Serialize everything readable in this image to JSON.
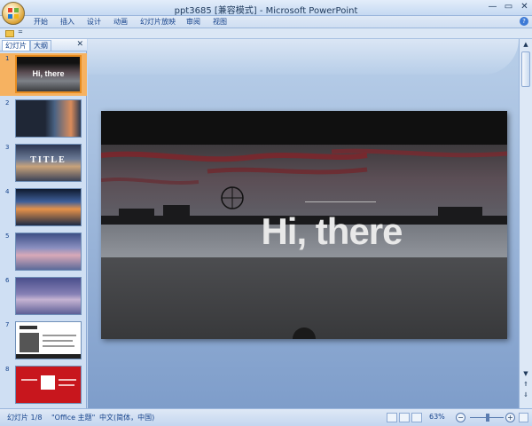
{
  "window": {
    "title": "ppt3685 [兼容模式] - Microsoft PowerPoint",
    "minimize": "—",
    "maximize": "▭",
    "close": "✕"
  },
  "ribbon_tabs": [
    "开始",
    "插入",
    "设计",
    "动画",
    "幻灯片放映",
    "审阅",
    "视图"
  ],
  "quick_access": {
    "dropdown": "="
  },
  "left_pane": {
    "tabs": [
      "幻灯片",
      "大纲"
    ],
    "close": "✕",
    "slides": [
      {
        "number": "1",
        "label": "Hi, there",
        "selected": true
      },
      {
        "number": "2",
        "label": "",
        "selected": false
      },
      {
        "number": "3",
        "label": "TITLE",
        "selected": false
      },
      {
        "number": "4",
        "label": "",
        "selected": false
      },
      {
        "number": "5",
        "label": "",
        "selected": false
      },
      {
        "number": "6",
        "label": "",
        "selected": false
      },
      {
        "number": "7",
        "label": "",
        "selected": false
      },
      {
        "number": "8",
        "label": "",
        "selected": false
      }
    ]
  },
  "slide": {
    "title": "Hi, there"
  },
  "status_bar": {
    "slide_position": "幻灯片 1/8",
    "theme": "\"Office 主题\"",
    "language": "中文(简体，中国)",
    "zoom": "63%",
    "zoom_out": "−",
    "zoom_in": "+"
  },
  "colors": {
    "selected_thumb": "#f6b261",
    "ribbon_text": "#15428b",
    "workspace": "#7e9dca"
  }
}
